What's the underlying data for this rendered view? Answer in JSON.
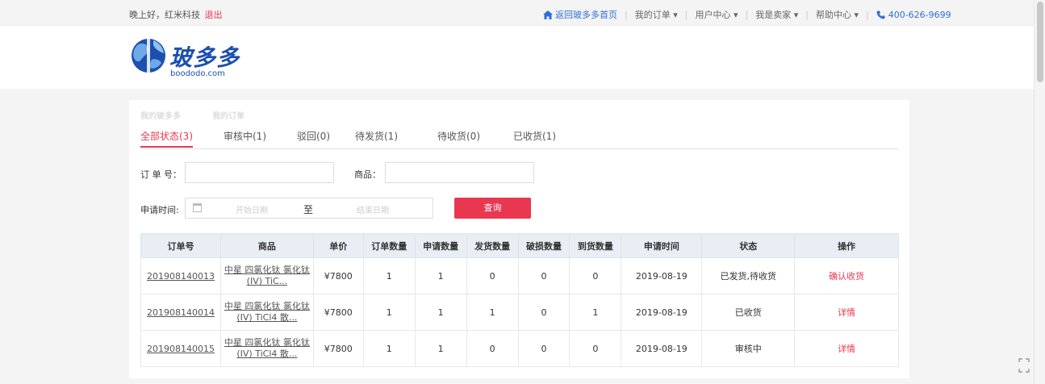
{
  "topbar": {
    "greeting": "晚上好，红米科技",
    "logout": "退出",
    "home_link": "返回玻多多首页",
    "my_orders": "我的订单",
    "user_center": "用户中心",
    "seller": "我是卖家",
    "help": "帮助中心",
    "phone": "400-626-9699"
  },
  "logo": {
    "brand": "玻多多",
    "domain": "boododo.com"
  },
  "breadcrumb": [
    "我的玻多多",
    "我的订单"
  ],
  "tabs": [
    {
      "label": "全部状态(3)",
      "active": true
    },
    {
      "label": "审核中(1)",
      "active": false
    },
    {
      "label": "驳回(0)",
      "active": false
    },
    {
      "label": "待发货(1)",
      "active": false
    },
    {
      "label": "待收货(0)",
      "active": false
    },
    {
      "label": "已收货(1)",
      "active": false
    }
  ],
  "filters": {
    "order_no_label": "订 单 号：",
    "order_no_value": "",
    "product_label": "商品：",
    "product_value": "",
    "date_label": "申请时间:",
    "start_placeholder": "开始日期",
    "to": "至",
    "end_placeholder": "结束日期",
    "query_button": "查询"
  },
  "table": {
    "headers": [
      "订单号",
      "商品",
      "单价",
      "订单数量",
      "申请数量",
      "发货数量",
      "破损数量",
      "到货数量",
      "申请时间",
      "状态",
      "操作"
    ],
    "rows": [
      {
        "order_no": "201908140013",
        "product_line1": "中星 四氯化钛 氯化钛",
        "product_line2": "(IV) TiC...",
        "price": "¥7800",
        "order_qty": "1",
        "apply_qty": "1",
        "ship_qty": "0",
        "broken_qty": "0",
        "arrive_qty": "0",
        "date": "2019-08-19",
        "status": "已发货,待收货",
        "action": "确认收货"
      },
      {
        "order_no": "201908140014",
        "product_line1": "中星 四氯化钛 氯化钛",
        "product_line2": "(IV) TiCl4 散...",
        "price": "¥7800",
        "order_qty": "1",
        "apply_qty": "1",
        "ship_qty": "1",
        "broken_qty": "0",
        "arrive_qty": "1",
        "date": "2019-08-19",
        "status": "已收货",
        "action": "详情"
      },
      {
        "order_no": "201908140015",
        "product_line1": "中星 四氯化钛 氯化钛",
        "product_line2": "(IV) TiCl4 散...",
        "price": "¥7800",
        "order_qty": "1",
        "apply_qty": "1",
        "ship_qty": "0",
        "broken_qty": "0",
        "arrive_qty": "0",
        "date": "2019-08-19",
        "status": "审核中",
        "action": "详情"
      }
    ]
  },
  "colors": {
    "accent": "#e8374f",
    "link_blue": "#2d6fd6",
    "brand_blue": "#1c4fae",
    "header_bg": "#e9eef4"
  },
  "icons": [
    "home-icon",
    "chevron-down-icon",
    "phone-icon",
    "calendar-icon",
    "fullscreen-icon"
  ]
}
